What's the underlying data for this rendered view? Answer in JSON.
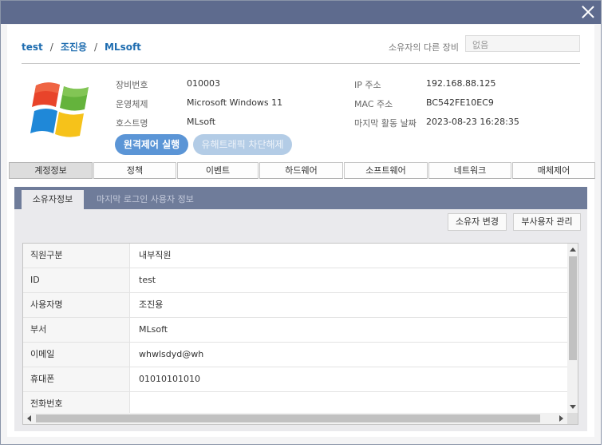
{
  "breadcrumb": {
    "group": "test",
    "user": "조진용",
    "dept": "MLsoft"
  },
  "other_devices": {
    "label": "소유자의 다른 장비",
    "value": "없음"
  },
  "device_info": {
    "device_no_label": "장비번호",
    "device_no": "010003",
    "os_label": "운영체제",
    "os": "Microsoft Windows 11",
    "host_label": "호스트명",
    "host": "MLsoft",
    "ip_label": "IP 주소",
    "ip": "192.168.88.125",
    "mac_label": "MAC 주소",
    "mac": "BC542FE10EC9",
    "last_active_label": "마지막 활동 날짜",
    "last_active": "2023-08-23 16:28:35"
  },
  "actions": {
    "remote_control": "원격제어 실행",
    "block_release": "유해트래픽 차단해제"
  },
  "tabs": [
    "계정정보",
    "정책",
    "이벤트",
    "하드웨어",
    "소프트웨어",
    "네트워크",
    "매체제어"
  ],
  "subtabs": {
    "active": "소유자정보",
    "other": "마지막 로그인 사용자 정보"
  },
  "panel_buttons": {
    "change_owner": "소유자 변경",
    "manage_sub_users": "부사용자 관리"
  },
  "owner_table": [
    {
      "key": "직원구분",
      "value": "내부직원"
    },
    {
      "key": "ID",
      "value": "test"
    },
    {
      "key": "사용자명",
      "value": "조진용"
    },
    {
      "key": "부서",
      "value": "MLsoft"
    },
    {
      "key": "이메일",
      "value": "whwlsdyd@wh"
    },
    {
      "key": "휴대폰",
      "value": "01010101010"
    },
    {
      "key": "전화번호",
      "value": ""
    }
  ],
  "colors": {
    "titlebar": "#5e6b8e",
    "accent": "#5b95d6",
    "link": "#1f6db0",
    "subtabbar": "#6f7c9a"
  },
  "icons": {
    "close": "close-icon",
    "os_logo": "windows-logo-icon"
  }
}
